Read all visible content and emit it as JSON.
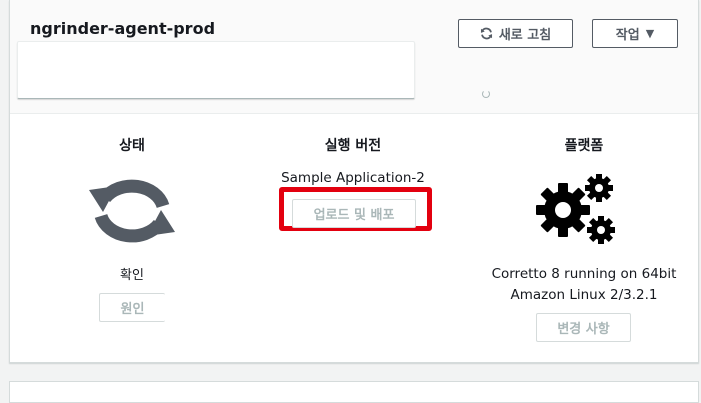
{
  "environment": {
    "name": "ngrinder-agent-prod"
  },
  "toolbar": {
    "refresh_label": "새로 고침",
    "actions_label": "작업"
  },
  "status": {
    "title": "상태",
    "value": "확인",
    "reason_button": "원인"
  },
  "running_version": {
    "title": "실행 버전",
    "version_label": "Sample Application-2",
    "upload_button": "업로드 및 배포"
  },
  "platform": {
    "title": "플랫폼",
    "line1": "Corretto 8 running on 64bit",
    "line2": "Amazon Linux 2/3.2.1",
    "change_button": "변경 사항"
  },
  "colors": {
    "highlight": "#e3000f",
    "status_icon": "#545b64",
    "gears_icon": "#000000"
  }
}
